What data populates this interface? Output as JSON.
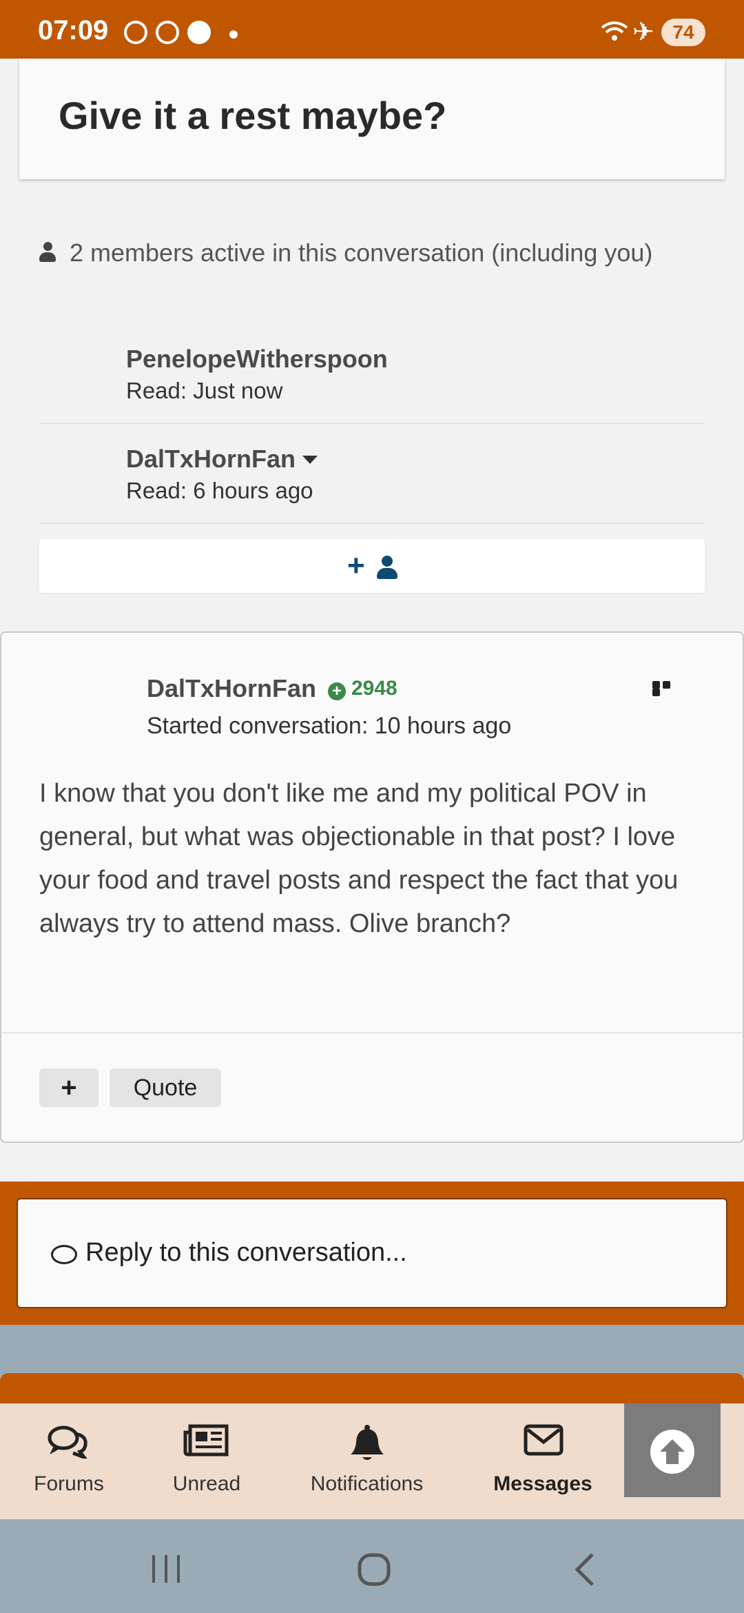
{
  "status_bar": {
    "time": "07:09",
    "battery": "74",
    "wifi": "5"
  },
  "title": "Give it a rest maybe?",
  "members": {
    "heading": "2 members active in this conversation (including you)",
    "list": [
      {
        "name": "PenelopeWitherspoon",
        "read": "Read: Just now"
      },
      {
        "name": "DalTxHornFan",
        "read": "Read: 6 hours ago"
      }
    ],
    "invite_icons": [
      "plus-icon",
      "user-icon"
    ]
  },
  "message": {
    "author": "DalTxHornFan",
    "reputation": "2948",
    "started": "Started conversation: 10 hours ago",
    "body": "I know that you don't like me and my political POV in general, but what was objectionable in that post?  I love your food and travel posts and respect the fact that you always try to attend mass.  Olive branch?",
    "actions": {
      "plus": "+",
      "quote": "Quote"
    }
  },
  "reply": {
    "placeholder": "Reply to this conversation..."
  },
  "bottom_nav": {
    "items": [
      {
        "label": "Forums",
        "icon": "chat-bubbles-icon"
      },
      {
        "label": "Unread",
        "icon": "newspaper-icon"
      },
      {
        "label": "Notifications",
        "icon": "bell-icon"
      },
      {
        "label": "Messages",
        "icon": "envelope-icon",
        "active": true
      }
    ]
  },
  "colors": {
    "brand": "#c05600",
    "accent_blue": "#0f4a74",
    "rep_green": "#3a8a4a"
  }
}
